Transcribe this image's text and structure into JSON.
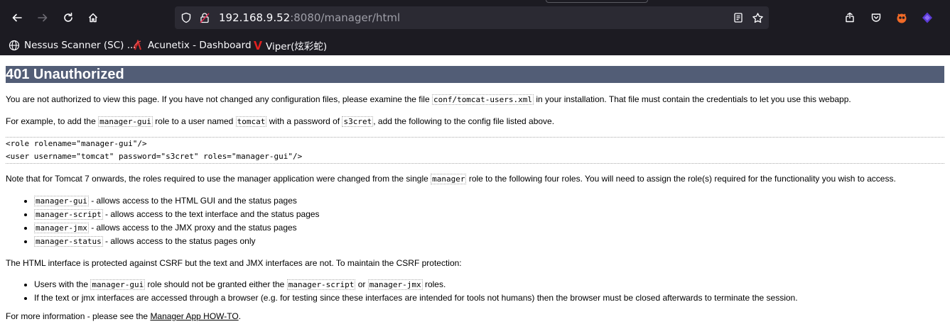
{
  "browser": {
    "url_host": "192.168.9.52",
    "url_rest": ":8080/manager/html",
    "icons": [
      "back-icon",
      "forward-icon",
      "reload-icon",
      "home-icon",
      "shield-icon",
      "lock-icon",
      "reader-view-icon",
      "bookmark-star-icon",
      "save-icon",
      "pocket-icon",
      "extension-icon",
      "extension2-icon"
    ]
  },
  "bookmarks": [
    {
      "label": "Nessus Scanner (SC) ...",
      "icon": "globe-icon"
    },
    {
      "label": "Acunetix - Dashboard",
      "icon": "acunetix-icon"
    },
    {
      "label": "Viper(炫彩蛇)",
      "icon": "viper-icon"
    }
  ],
  "page": {
    "title": "401 Unauthorized",
    "p1_a": "You are not authorized to view this page. If you have not changed any configuration files, please examine the file ",
    "p1_code": "conf/tomcat-users.xml",
    "p1_b": " in your installation. That file must contain the credentials to let you use this webapp.",
    "p2_a": "For example, to add the ",
    "p2_code1": "manager-gui",
    "p2_b": " role to a user named ",
    "p2_code2": "tomcat",
    "p2_c": " with a password of ",
    "p2_code3": "s3cret",
    "p2_d": ", add the following to the config file listed above.",
    "pre_line1": "<role rolename=\"manager-gui\"/>",
    "pre_line2": "<user username=\"tomcat\" password=\"s3cret\" roles=\"manager-gui\"/>",
    "p3_a": "Note that for Tomcat 7 onwards, the roles required to use the manager application were changed from the single ",
    "p3_code": "manager",
    "p3_b": " role to the following four roles. You will need to assign the role(s) required for the functionality you wish to access.",
    "roles": [
      {
        "code": "manager-gui",
        "text": " - allows access to the HTML GUI and the status pages"
      },
      {
        "code": "manager-script",
        "text": " - allows access to the text interface and the status pages"
      },
      {
        "code": "manager-jmx",
        "text": " - allows access to the JMX proxy and the status pages"
      },
      {
        "code": "manager-status",
        "text": " - allows access to the status pages only"
      }
    ],
    "p4": "The HTML interface is protected against CSRF but the text and JMX interfaces are not. To maintain the CSRF protection:",
    "csrf1_a": "Users with the ",
    "csrf1_code1": "manager-gui",
    "csrf1_b": " role should not be granted either the ",
    "csrf1_code2": "manager-script",
    "csrf1_c": " or ",
    "csrf1_code3": "manager-jmx",
    "csrf1_d": " roles.",
    "csrf2": "If the text or jmx interfaces are accessed through a browser (e.g. for testing since these interfaces are intended for tools not humans) then the browser must be closed afterwards to terminate the session.",
    "p5_a": "For more information - please see the ",
    "p5_link": "Manager App HOW-TO",
    "p5_b": "."
  }
}
